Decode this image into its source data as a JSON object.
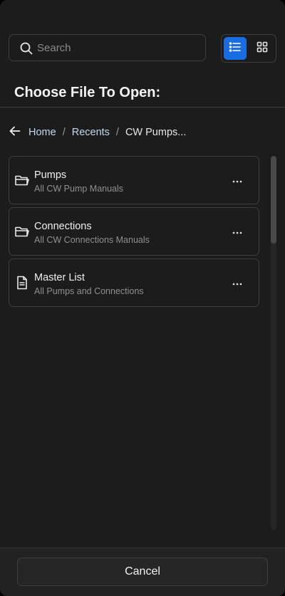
{
  "search": {
    "placeholder": "Search",
    "icon": "search-icon"
  },
  "view_toggle": {
    "selected": "list",
    "options": [
      "list",
      "grid"
    ],
    "accent_color": "#1a6de0"
  },
  "dialog": {
    "title": "Choose File To Open:"
  },
  "breadcrumb": {
    "back_icon": "arrow-left-icon",
    "items": [
      "Home",
      "Recents",
      "CW Pumps..."
    ],
    "separator": "/"
  },
  "files": [
    {
      "name": "Pumps",
      "description": "All CW Pump Manuals",
      "icon": "folder-icon"
    },
    {
      "name": "Connections",
      "description": "All CW Connections Manuals",
      "icon": "folder-icon"
    },
    {
      "name": "Master List",
      "description": "All Pumps and Connections",
      "icon": "file-document-icon"
    }
  ],
  "footer": {
    "cancel_label": "Cancel"
  }
}
